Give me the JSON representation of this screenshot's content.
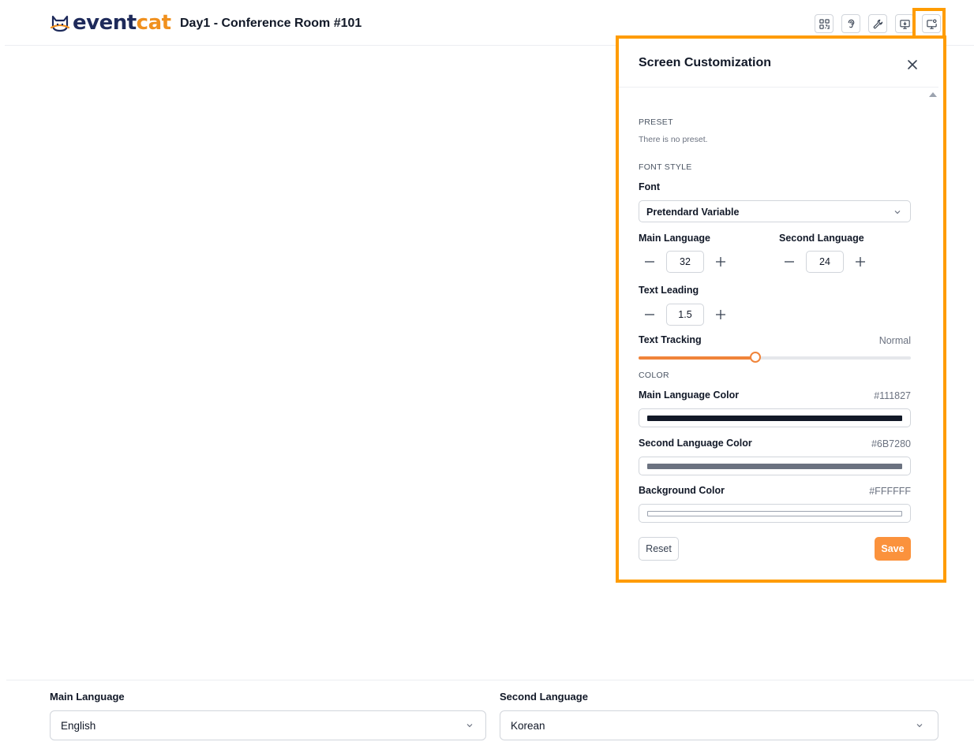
{
  "app": {
    "logo_part1": "event",
    "logo_part2": "cat",
    "room_title": "Day1 - Conference Room #101",
    "brand_color": "#f0901e",
    "highlight_color": "#ff9c00"
  },
  "toolbar": {
    "buttons": [
      {
        "icon": "qr-code-icon"
      },
      {
        "icon": "ear-icon"
      },
      {
        "icon": "wrench-icon"
      },
      {
        "icon": "monitor-icon"
      },
      {
        "icon": "screen-settings-icon"
      }
    ]
  },
  "panel": {
    "title": "Screen Customization",
    "preset": {
      "section": "PRESET",
      "empty_text": "There is no preset."
    },
    "font_style": {
      "section": "FONT STYLE",
      "font_label": "Font",
      "font_value": "Pretendard Variable",
      "main_language_label": "Main Language",
      "main_language_size": "32",
      "second_language_label": "Second Language",
      "second_language_size": "24",
      "text_leading_label": "Text Leading",
      "text_leading_value": "1.5",
      "text_tracking_label": "Text Tracking",
      "text_tracking_value": "Normal",
      "text_tracking_fraction": 0.43
    },
    "color": {
      "section": "COLOR",
      "main_label": "Main Language Color",
      "main_value": "#111827",
      "second_label": "Second Language Color",
      "second_value": "#6B7280",
      "background_label": "Background Color",
      "background_value": "#FFFFFF"
    },
    "reset_label": "Reset",
    "save_label": "Save",
    "save_color": "#fb923c"
  },
  "bottom": {
    "main_language_label": "Main Language",
    "main_language_value": "English",
    "second_language_label": "Second Language",
    "second_language_value": "Korean"
  }
}
